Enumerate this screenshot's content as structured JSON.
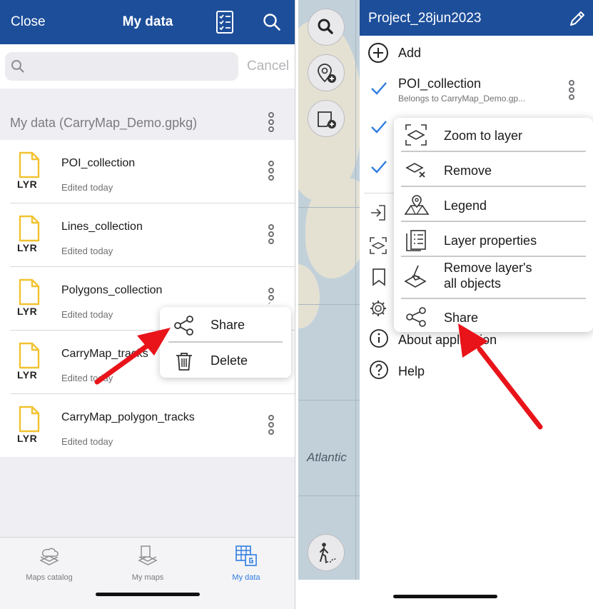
{
  "left": {
    "header": {
      "close_label": "Close",
      "title": "My data"
    },
    "search": {
      "placeholder": "",
      "cancel_label": "Cancel"
    },
    "section_title": "My data (CarryMap_Demo.gpkg)",
    "layers": [
      {
        "name": "POI_collection",
        "subtitle": "Edited today",
        "icon_label": "LYR"
      },
      {
        "name": "Lines_collection",
        "subtitle": "Edited today",
        "icon_label": "LYR"
      },
      {
        "name": "Polygons_collection",
        "subtitle": "Edited today",
        "icon_label": "LYR"
      },
      {
        "name": "CarryMap_tracks",
        "subtitle": "Edited today",
        "icon_label": "LYR"
      },
      {
        "name": "CarryMap_polygon_tracks",
        "subtitle": "Edited today",
        "icon_label": "LYR"
      }
    ],
    "popup_menu": [
      {
        "label": "Share",
        "icon": "share-icon"
      },
      {
        "label": "Delete",
        "icon": "trash-icon"
      }
    ],
    "tabs": [
      {
        "label": "Maps catalog",
        "icon": "maps-catalog-icon",
        "active": false
      },
      {
        "label": "My maps",
        "icon": "my-maps-icon",
        "active": false
      },
      {
        "label": "My data",
        "icon": "my-data-icon",
        "active": true
      }
    ]
  },
  "right": {
    "header": {
      "title": "Project_28jun2023"
    },
    "add_label": "Add",
    "layers": [
      {
        "name": "POI_collection",
        "subtitle": "Belongs to CarryMap_Demo.gp...",
        "checked": true
      }
    ],
    "context_menu": [
      {
        "label": "Zoom to layer",
        "icon": "zoom-to-layer-icon"
      },
      {
        "label": "Remove",
        "icon": "remove-icon"
      },
      {
        "label": "Legend",
        "icon": "legend-icon"
      },
      {
        "label": "Layer properties",
        "icon": "layer-properties-icon"
      },
      {
        "label": "Remove layer's all objects",
        "line1": "Remove layer's",
        "line2": "all objects",
        "icon": "clear-objects-icon"
      },
      {
        "label": "Share",
        "icon": "share-icon"
      }
    ],
    "menu": [
      {
        "label": "About application",
        "icon": "info-icon"
      },
      {
        "label": "Help",
        "icon": "help-icon"
      }
    ],
    "map_label": "Atlantic"
  },
  "colors": {
    "header": "#1d4e9a",
    "accent": "#2f7de1",
    "arrow": "#e8141a",
    "file_icon": "#f2c230"
  }
}
